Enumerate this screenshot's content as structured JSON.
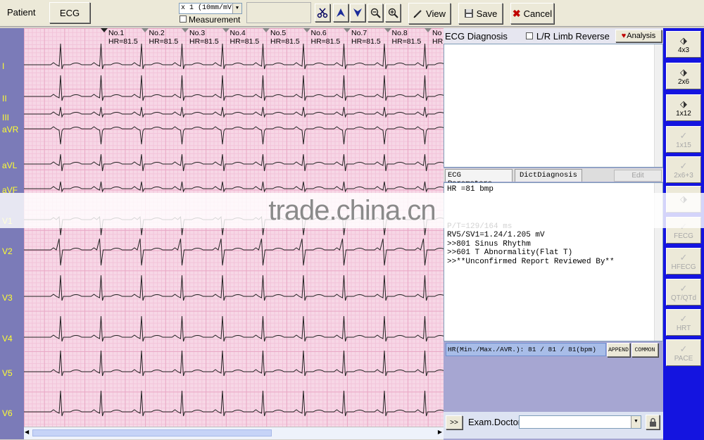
{
  "toolbar": {
    "patient_tab": "Patient",
    "ecg_tab": "ECG",
    "gain_select": "x 1 (10mm/mV",
    "measurement_label": "Measurement",
    "view_label": "View",
    "save_label": "Save",
    "cancel_label": "Cancel"
  },
  "leads": [
    "I",
    "II",
    "III",
    "aVR",
    "aVL",
    "aVF",
    "V1",
    "V2",
    "V3",
    "V4",
    "V5",
    "V6"
  ],
  "beats": [
    {
      "no": "No.1",
      "hr": "HR=81.5"
    },
    {
      "no": "No.2",
      "hr": "HR=81.5"
    },
    {
      "no": "No.3",
      "hr": "HR=81.5"
    },
    {
      "no": "No.4",
      "hr": "HR=81.5"
    },
    {
      "no": "No.5",
      "hr": "HR=81.5"
    },
    {
      "no": "No.6",
      "hr": "HR=81.5"
    },
    {
      "no": "No.7",
      "hr": "HR=81.5"
    },
    {
      "no": "No.8",
      "hr": "HR=81.5"
    },
    {
      "no": "No",
      "hr": "HR"
    }
  ],
  "diagnosis": {
    "title": "ECG Diagnosis",
    "limb_reverse_label": "L/R Limb Reverse",
    "analysis_label": "Analysis"
  },
  "tabs": {
    "params": "ECG Parameters",
    "dict": "DictDiagnosis",
    "edit": "Edit"
  },
  "params_lines": [
    "HR =81 bmp",
    "P/T=129/164 ms",
    "RV5/SV1=1.24/1.205 mV",
    ">>801 Sinus Rhythm",
    ">>601 T Abnormality(Flat T)",
    ">>**Unconfirmed Report Reviewed By**"
  ],
  "hr_summary": "HR(Min./Max./AVR.): 81 / 81 / 81(bpm)",
  "append_label": "APPEND",
  "common_label": "COMMON",
  "bottom": {
    "arrow_label": ">>",
    "doctor_label": "Exam.Doctor",
    "doctor_value": ""
  },
  "side_buttons": [
    {
      "label": "4x3",
      "enabled": true
    },
    {
      "label": "2x6",
      "enabled": true
    },
    {
      "label": "1x12",
      "enabled": true
    },
    {
      "label": "1x15",
      "enabled": false
    },
    {
      "label": "2x6+3",
      "enabled": false
    },
    {
      "label": "",
      "enabled": true
    },
    {
      "label": "FECG",
      "enabled": false
    },
    {
      "label": "HFECG",
      "enabled": false
    },
    {
      "label": "QT/QTd",
      "enabled": false
    },
    {
      "label": "HRT",
      "enabled": false
    },
    {
      "label": "PACE",
      "enabled": false
    }
  ],
  "watermark": "trade.china.cn"
}
